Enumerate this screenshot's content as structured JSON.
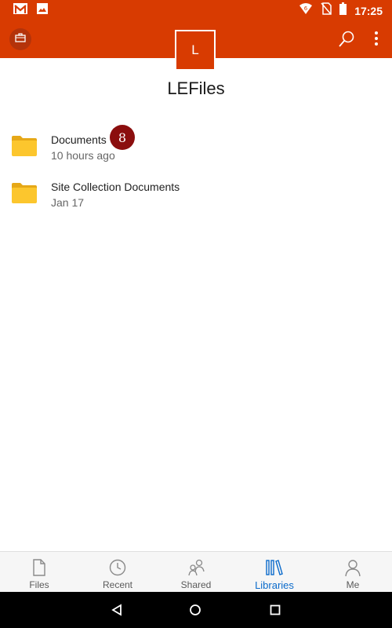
{
  "status_bar": {
    "time": "17:25",
    "icons": [
      "gmail-icon",
      "image-icon",
      "wifi-icon",
      "no-sim-icon",
      "battery-icon"
    ]
  },
  "header": {
    "site_initial": "L",
    "site_title": "LEFiles",
    "accent_color": "#d83b01"
  },
  "libraries": [
    {
      "name": "Documents",
      "modified": "10 hours ago",
      "badge": "8"
    },
    {
      "name": "Site Collection Documents",
      "modified": "Jan 17"
    }
  ],
  "bottom_nav": {
    "items": [
      {
        "label": "Files",
        "icon": "file-icon"
      },
      {
        "label": "Recent",
        "icon": "clock-icon"
      },
      {
        "label": "Shared",
        "icon": "people-icon"
      },
      {
        "label": "Libraries",
        "icon": "libraries-icon",
        "active": true
      },
      {
        "label": "Me",
        "icon": "person-icon"
      }
    ],
    "active_color": "#0b6bcb"
  }
}
